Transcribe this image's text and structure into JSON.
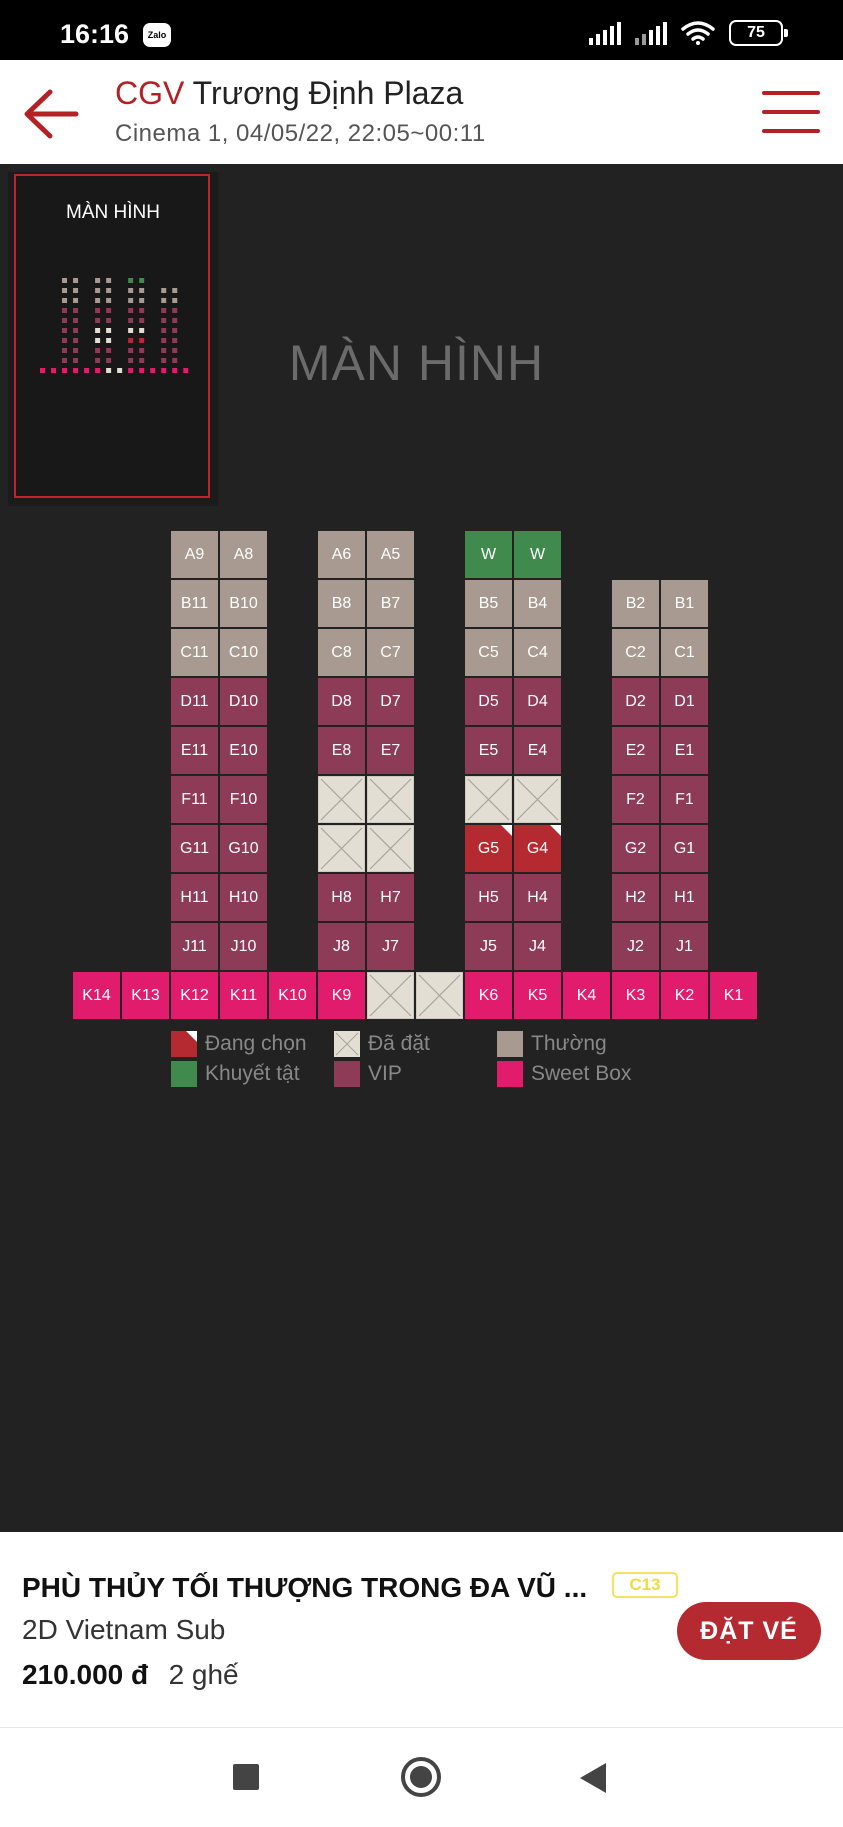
{
  "status_bar": {
    "time": "16:16",
    "notification_app": "Zalo",
    "battery": "75"
  },
  "header": {
    "brand": "CGV",
    "cinema_name": "Trương Định Plaza",
    "subtitle": "Cinema 1, 04/05/22, 22:05~00:11",
    "accent_color": "#b52025"
  },
  "minimap": {
    "label": "MÀN HÌNH"
  },
  "screen_label": "MÀN HÌNH",
  "seat_colors": {
    "normal": "#a89a90",
    "vip": "#8e3b57",
    "sweet": "#e11c6d",
    "disabled": "#3f8a4c",
    "selected": "#b52a30",
    "booked": "#e3ded4"
  },
  "seats": [
    {
      "label": "A9",
      "type": "normal",
      "row": 0,
      "col": 2
    },
    {
      "label": "A8",
      "type": "normal",
      "row": 0,
      "col": 3
    },
    {
      "label": "A6",
      "type": "normal",
      "row": 0,
      "col": 5
    },
    {
      "label": "A5",
      "type": "normal",
      "row": 0,
      "col": 6
    },
    {
      "label": "W",
      "type": "disabled",
      "row": 0,
      "col": 8
    },
    {
      "label": "W",
      "type": "disabled",
      "row": 0,
      "col": 9
    },
    {
      "label": "B11",
      "type": "normal",
      "row": 1,
      "col": 2
    },
    {
      "label": "B10",
      "type": "normal",
      "row": 1,
      "col": 3
    },
    {
      "label": "B8",
      "type": "normal",
      "row": 1,
      "col": 5
    },
    {
      "label": "B7",
      "type": "normal",
      "row": 1,
      "col": 6
    },
    {
      "label": "B5",
      "type": "normal",
      "row": 1,
      "col": 8
    },
    {
      "label": "B4",
      "type": "normal",
      "row": 1,
      "col": 9
    },
    {
      "label": "B2",
      "type": "normal",
      "row": 1,
      "col": 11
    },
    {
      "label": "B1",
      "type": "normal",
      "row": 1,
      "col": 12
    },
    {
      "label": "C11",
      "type": "normal",
      "row": 2,
      "col": 2
    },
    {
      "label": "C10",
      "type": "normal",
      "row": 2,
      "col": 3
    },
    {
      "label": "C8",
      "type": "normal",
      "row": 2,
      "col": 5
    },
    {
      "label": "C7",
      "type": "normal",
      "row": 2,
      "col": 6
    },
    {
      "label": "C5",
      "type": "normal",
      "row": 2,
      "col": 8
    },
    {
      "label": "C4",
      "type": "normal",
      "row": 2,
      "col": 9
    },
    {
      "label": "C2",
      "type": "normal",
      "row": 2,
      "col": 11
    },
    {
      "label": "C1",
      "type": "normal",
      "row": 2,
      "col": 12
    },
    {
      "label": "D11",
      "type": "vip",
      "row": 3,
      "col": 2
    },
    {
      "label": "D10",
      "type": "vip",
      "row": 3,
      "col": 3
    },
    {
      "label": "D8",
      "type": "vip",
      "row": 3,
      "col": 5
    },
    {
      "label": "D7",
      "type": "vip",
      "row": 3,
      "col": 6
    },
    {
      "label": "D5",
      "type": "vip",
      "row": 3,
      "col": 8
    },
    {
      "label": "D4",
      "type": "vip",
      "row": 3,
      "col": 9
    },
    {
      "label": "D2",
      "type": "vip",
      "row": 3,
      "col": 11
    },
    {
      "label": "D1",
      "type": "vip",
      "row": 3,
      "col": 12
    },
    {
      "label": "E11",
      "type": "vip",
      "row": 4,
      "col": 2
    },
    {
      "label": "E10",
      "type": "vip",
      "row": 4,
      "col": 3
    },
    {
      "label": "E8",
      "type": "vip",
      "row": 4,
      "col": 5
    },
    {
      "label": "E7",
      "type": "vip",
      "row": 4,
      "col": 6
    },
    {
      "label": "E5",
      "type": "vip",
      "row": 4,
      "col": 8
    },
    {
      "label": "E4",
      "type": "vip",
      "row": 4,
      "col": 9
    },
    {
      "label": "E2",
      "type": "vip",
      "row": 4,
      "col": 11
    },
    {
      "label": "E1",
      "type": "vip",
      "row": 4,
      "col": 12
    },
    {
      "label": "F11",
      "type": "vip",
      "row": 5,
      "col": 2
    },
    {
      "label": "F10",
      "type": "vip",
      "row": 5,
      "col": 3
    },
    {
      "label": "",
      "type": "booked",
      "row": 5,
      "col": 5
    },
    {
      "label": "",
      "type": "booked",
      "row": 5,
      "col": 6
    },
    {
      "label": "",
      "type": "booked",
      "row": 5,
      "col": 8
    },
    {
      "label": "",
      "type": "booked",
      "row": 5,
      "col": 9
    },
    {
      "label": "F2",
      "type": "vip",
      "row": 5,
      "col": 11
    },
    {
      "label": "F1",
      "type": "vip",
      "row": 5,
      "col": 12
    },
    {
      "label": "G11",
      "type": "vip",
      "row": 6,
      "col": 2
    },
    {
      "label": "G10",
      "type": "vip",
      "row": 6,
      "col": 3
    },
    {
      "label": "",
      "type": "booked",
      "row": 6,
      "col": 5
    },
    {
      "label": "",
      "type": "booked",
      "row": 6,
      "col": 6
    },
    {
      "label": "G5",
      "type": "selected",
      "row": 6,
      "col": 8
    },
    {
      "label": "G4",
      "type": "selected",
      "row": 6,
      "col": 9
    },
    {
      "label": "G2",
      "type": "vip",
      "row": 6,
      "col": 11
    },
    {
      "label": "G1",
      "type": "vip",
      "row": 6,
      "col": 12
    },
    {
      "label": "H11",
      "type": "vip",
      "row": 7,
      "col": 2
    },
    {
      "label": "H10",
      "type": "vip",
      "row": 7,
      "col": 3
    },
    {
      "label": "H8",
      "type": "vip",
      "row": 7,
      "col": 5
    },
    {
      "label": "H7",
      "type": "vip",
      "row": 7,
      "col": 6
    },
    {
      "label": "H5",
      "type": "vip",
      "row": 7,
      "col": 8
    },
    {
      "label": "H4",
      "type": "vip",
      "row": 7,
      "col": 9
    },
    {
      "label": "H2",
      "type": "vip",
      "row": 7,
      "col": 11
    },
    {
      "label": "H1",
      "type": "vip",
      "row": 7,
      "col": 12
    },
    {
      "label": "J11",
      "type": "vip",
      "row": 8,
      "col": 2
    },
    {
      "label": "J10",
      "type": "vip",
      "row": 8,
      "col": 3
    },
    {
      "label": "J8",
      "type": "vip",
      "row": 8,
      "col": 5
    },
    {
      "label": "J7",
      "type": "vip",
      "row": 8,
      "col": 6
    },
    {
      "label": "J5",
      "type": "vip",
      "row": 8,
      "col": 8
    },
    {
      "label": "J4",
      "type": "vip",
      "row": 8,
      "col": 9
    },
    {
      "label": "J2",
      "type": "vip",
      "row": 8,
      "col": 11
    },
    {
      "label": "J1",
      "type": "vip",
      "row": 8,
      "col": 12
    },
    {
      "label": "K14",
      "type": "sweet",
      "row": 9,
      "col": 0
    },
    {
      "label": "K13",
      "type": "sweet",
      "row": 9,
      "col": 1
    },
    {
      "label": "K12",
      "type": "sweet",
      "row": 9,
      "col": 2
    },
    {
      "label": "K11",
      "type": "sweet",
      "row": 9,
      "col": 3
    },
    {
      "label": "K10",
      "type": "sweet",
      "row": 9,
      "col": 4
    },
    {
      "label": "K9",
      "type": "sweet",
      "row": 9,
      "col": 5
    },
    {
      "label": "",
      "type": "booked",
      "row": 9,
      "col": 6
    },
    {
      "label": "",
      "type": "booked",
      "row": 9,
      "col": 7
    },
    {
      "label": "K6",
      "type": "sweet",
      "row": 9,
      "col": 8
    },
    {
      "label": "K5",
      "type": "sweet",
      "row": 9,
      "col": 9
    },
    {
      "label": "K4",
      "type": "sweet",
      "row": 9,
      "col": 10
    },
    {
      "label": "K3",
      "type": "sweet",
      "row": 9,
      "col": 11
    },
    {
      "label": "K2",
      "type": "sweet",
      "row": 9,
      "col": 12
    },
    {
      "label": "K1",
      "type": "sweet",
      "row": 9,
      "col": 13
    }
  ],
  "legend": {
    "selected": "Đang chọn",
    "booked": "Đã đặt",
    "normal": "Thường",
    "disabled": "Khuyết tật",
    "vip": "VIP",
    "sweet": "Sweet Box"
  },
  "movie": {
    "title": "PHÙ THỦY TỐI THƯỢNG TRONG ĐA VŨ ...",
    "rating": "C13",
    "format": "2D Vietnam Sub",
    "price": "210.000 đ",
    "seat_count": "2 ghế"
  },
  "book_button": "ĐẶT VÉ"
}
